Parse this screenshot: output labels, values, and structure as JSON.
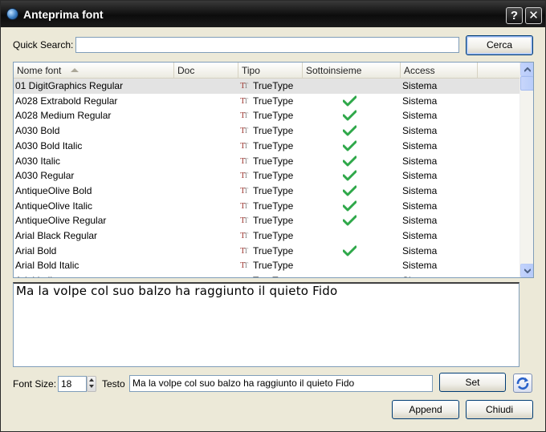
{
  "window": {
    "title": "Anteprima font",
    "help_label": "?",
    "close_label": "✕"
  },
  "search": {
    "label": "Quick Search:",
    "value": "",
    "button_label": "Cerca"
  },
  "table": {
    "columns": [
      "Nome font",
      "Doc",
      "Tipo",
      "Sottoinsieme",
      "Access"
    ],
    "sorted_by": "Nome font",
    "rows": [
      {
        "name": "01 DigitGraphics Regular",
        "type": "TrueType",
        "subset": false,
        "access": "Sistema",
        "selected": true
      },
      {
        "name": "A028 Extrabold Regular",
        "type": "TrueType",
        "subset": true,
        "access": "Sistema"
      },
      {
        "name": "A028 Medium Regular",
        "type": "TrueType",
        "subset": true,
        "access": "Sistema"
      },
      {
        "name": "A030 Bold",
        "type": "TrueType",
        "subset": true,
        "access": "Sistema"
      },
      {
        "name": "A030 Bold Italic",
        "type": "TrueType",
        "subset": true,
        "access": "Sistema"
      },
      {
        "name": "A030 Italic",
        "type": "TrueType",
        "subset": true,
        "access": "Sistema"
      },
      {
        "name": "A030 Regular",
        "type": "TrueType",
        "subset": true,
        "access": "Sistema"
      },
      {
        "name": "AntiqueOlive Bold",
        "type": "TrueType",
        "subset": true,
        "access": "Sistema"
      },
      {
        "name": "AntiqueOlive Italic",
        "type": "TrueType",
        "subset": true,
        "access": "Sistema"
      },
      {
        "name": "AntiqueOlive Regular",
        "type": "TrueType",
        "subset": true,
        "access": "Sistema"
      },
      {
        "name": "Arial Black Regular",
        "type": "TrueType",
        "subset": false,
        "access": "Sistema"
      },
      {
        "name": "Arial Bold",
        "type": "TrueType",
        "subset": true,
        "access": "Sistema"
      },
      {
        "name": "Arial Bold Italic",
        "type": "TrueType",
        "subset": false,
        "access": "Sistema"
      },
      {
        "name": "Arial Italic",
        "type": "TrueType",
        "subset": false,
        "access": "Sistema"
      }
    ]
  },
  "preview": {
    "text": "Ma la volpe col suo balzo ha raggiunto il quieto Fido"
  },
  "controls": {
    "font_size_label": "Font Size:",
    "font_size_value": "18",
    "text_label": "Testo",
    "text_value": "Ma la volpe col suo balzo ha raggiunto il quieto Fido",
    "set_label": "Set",
    "append_label": "Append",
    "close_label": "Chiudi"
  },
  "icons": {
    "app": "globe-icon",
    "type": "truetype-icon",
    "check": "check-icon",
    "refresh": "refresh-icon"
  },
  "colors": {
    "check_green": "#2fa84a",
    "truetype_red": "#a3403a",
    "selected_row": "#e3e3e3",
    "window_bg": "#ece9d8"
  }
}
